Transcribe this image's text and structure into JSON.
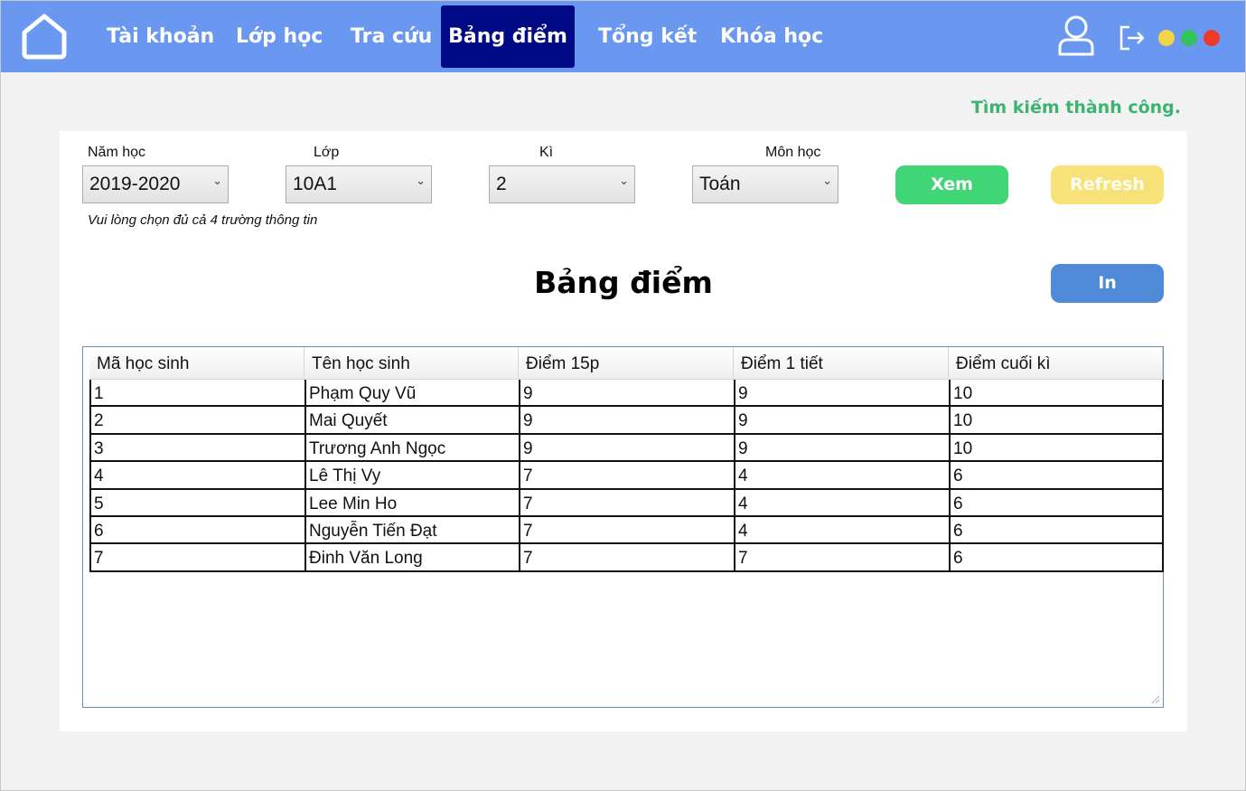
{
  "nav": {
    "items": [
      {
        "label": "Tài khoản"
      },
      {
        "label": "Lớp học"
      },
      {
        "label": "Tra cứu"
      },
      {
        "label": "Bảng điểm",
        "active": true
      },
      {
        "label": "Tổng kết"
      },
      {
        "label": "Khóa học"
      }
    ],
    "home_icon": "home-icon",
    "user_icon": "user-icon",
    "logout_icon": "logout-icon",
    "window_dots": [
      "#f2d545",
      "#33c35a",
      "#ee3a2a"
    ],
    "bar_color": "#6a97f0",
    "active_color": "#000a85"
  },
  "status": {
    "message": "Tìm kiếm thành công."
  },
  "filters": {
    "year": {
      "label": "Năm học",
      "value": "2019-2020"
    },
    "class": {
      "label": "Lớp",
      "value": "10A1"
    },
    "term": {
      "label": "Kì",
      "value": "2"
    },
    "subject": {
      "label": "Môn học",
      "value": "Toán"
    },
    "hint": "Vui lòng chọn đủ cả 4 trường thông tin"
  },
  "buttons": {
    "view": "Xem",
    "refresh": "Refresh",
    "print": "In"
  },
  "title": "Bảng điểm",
  "table": {
    "columns": [
      "Mã học sinh",
      "Tên học sinh",
      "Điểm 15p",
      "Điểm 1 tiết",
      "Điểm cuối kì"
    ],
    "rows": [
      [
        "1",
        "Phạm Quy Vũ",
        "9",
        "9",
        "10"
      ],
      [
        "2",
        "Mai Quyết",
        "9",
        "9",
        "10"
      ],
      [
        "3",
        "Trương Anh Ngọc",
        "9",
        "9",
        "10"
      ],
      [
        "4",
        "Lê Thị Vy",
        "7",
        "4",
        "6"
      ],
      [
        "5",
        "Lee Min Ho",
        "7",
        "4",
        "6"
      ],
      [
        "6",
        "Nguyễn Tiến Đạt",
        "7",
        "4",
        "6"
      ],
      [
        "7",
        "Đinh Văn Long",
        "7",
        "7",
        "6"
      ]
    ]
  }
}
